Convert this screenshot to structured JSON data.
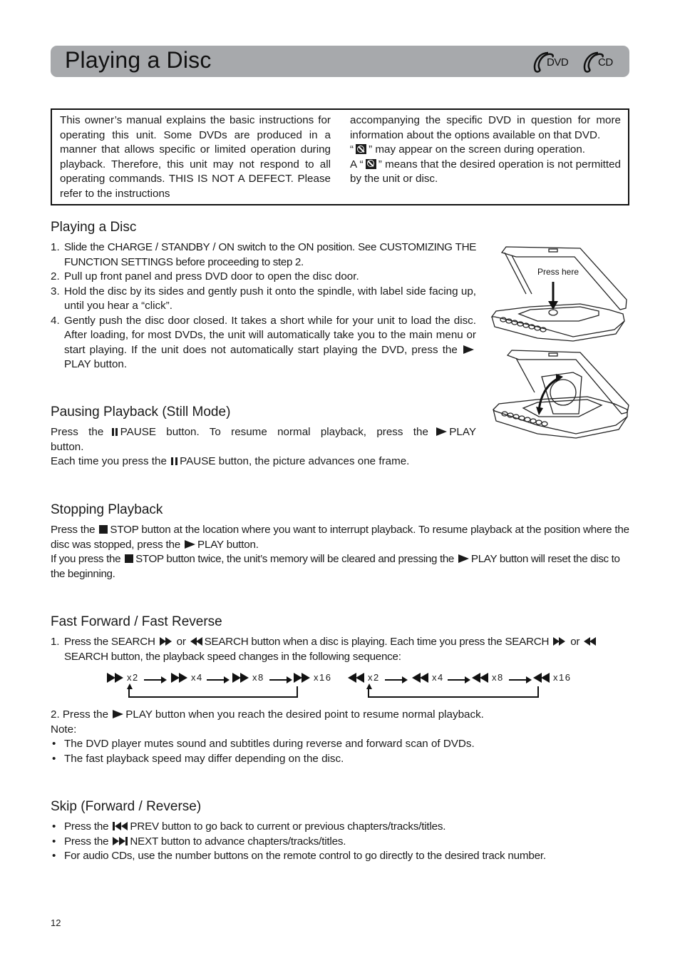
{
  "header": {
    "title": "Playing a Disc",
    "disc_logos": [
      "DVD",
      "CD"
    ]
  },
  "notice": {
    "left_text": "This owner’s manual explains the basic instructions for operating this unit. Some DVDs are produced in a manner that allows specific or limited operation during playback. Therefore, this unit may not respond to all operating commands.  THIS IS NOT A DEFECT.  Please refer to the instructions",
    "right_text_1": "accompanying the specific DVD in question for more information about the options available on that DVD.",
    "right_line_2_open": "“",
    "right_line_2_close": "” may appear on the screen during operation.",
    "right_line_3_open": "A “",
    "right_line_3_close": "” means that the desired operation is not permitted by the unit or disc."
  },
  "playing": {
    "title": "Playing a Disc",
    "steps": [
      {
        "num": "1.",
        "text": "Slide the CHARGE / STANDBY / ON switch to the ON position. See CUSTOMIZING THE FUNCTION SETTINGS before proceeding to step 2."
      },
      {
        "num": "2.",
        "text": "Pull up front panel and press DVD door to open the disc door."
      },
      {
        "num": "3.",
        "text": "Hold the disc by its sides and gently push it onto the spindle, with label side facing up, until you hear a “click”."
      },
      {
        "num": "4.",
        "text_before": "Gently push the disc door closed. It takes a short while for your unit to load the disc. After loading, for most DVDs, the unit will automatically take you to the main menu or start playing. If the unit does not automatically start playing the DVD, press the",
        "text_after": "PLAY button."
      }
    ],
    "figure_label": "Press here"
  },
  "pausing": {
    "title": "Pausing Playback (Still Mode)",
    "p1_a": "Press the",
    "p1_b": "PAUSE button. To resume normal playback, press the",
    "p1_c": "PLAY button.",
    "p2_a": "Each time you press the",
    "p2_b": "PAUSE button, the picture advances one frame."
  },
  "stopping": {
    "title": "Stopping Playback",
    "p1_a": "Press the",
    "p1_b": "STOP button at the location where you want to interrupt playback. To resume playback at the position where the disc was stopped, press the",
    "p1_c": "PLAY button.",
    "p2_a": "If you press the",
    "p2_b": "STOP button twice, the unit’s memory will be cleared and pressing the",
    "p2_c": "PLAY button will reset the disc to the beginning."
  },
  "fast": {
    "title": "Fast Forward / Fast Reverse",
    "step1_num": "1.",
    "step1_a": "Press the SEARCH",
    "step1_b": "or",
    "step1_c": "SEARCH button  when a disc is playing. Each time you press the SEARCH",
    "step1_d": "or",
    "step1_e": "SEARCH button, the playback speed changes in the following sequence:",
    "forward_sequence": [
      "x2",
      "x4",
      "x8",
      "x16"
    ],
    "reverse_sequence": [
      "x2",
      "x4",
      "x8",
      "x16"
    ],
    "step2_a": "2. Press the",
    "step2_b": "PLAY button when you reach the desired point to resume normal playback.",
    "note_label": "Note:",
    "notes": [
      "The DVD player mutes sound and subtitles during reverse and forward scan of DVDs.",
      "The fast playback speed may differ depending on the disc."
    ]
  },
  "skip": {
    "title": "Skip (Forward / Reverse)",
    "b1_a": "Press the",
    "b1_b": "PREV button to go back to current or previous chapters/tracks/titles.",
    "b2_a": "Press the",
    "b2_b": "NEXT button to advance chapters/tracks/titles.",
    "b3": "For audio CDs, use the number buttons on the remote control to go directly to the desired track number."
  },
  "footer": {
    "page_number": "12"
  }
}
